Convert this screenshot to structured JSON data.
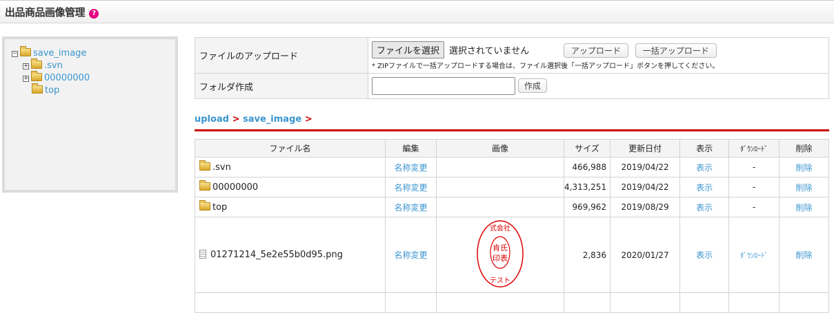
{
  "header": {
    "title": "出品商品画像管理",
    "help_icon": "?"
  },
  "tree": {
    "root": "save_image",
    "children": [
      {
        "label": ".svn",
        "expandable": true
      },
      {
        "label": "00000000",
        "expandable": true
      },
      {
        "label": "top",
        "expandable": false
      }
    ]
  },
  "upload": {
    "label": "ファイルのアップロード",
    "choose_label": "ファイルを選択",
    "no_file": "選択されていません",
    "upload_button": "アップロード",
    "bulk_button": "一括アップロード",
    "note": "* ZIPファイルで一括アップロードする場合は、ファイル選択後「一括アップロード」ボタンを押してください。"
  },
  "folder": {
    "label": "フォルダ作成",
    "value": "",
    "create_button": "作成"
  },
  "breadcrumb": {
    "items": [
      "upload",
      "save_image"
    ],
    "sep": ">"
  },
  "files": {
    "headers": [
      "ファイル名",
      "編集",
      "画像",
      "サイズ",
      "更新日付",
      "表示",
      "ﾀﾞｳﾝﾛｰﾄﾞ",
      "削除"
    ],
    "rows": [
      {
        "name": ".svn",
        "type": "folder",
        "edit": "名称変更",
        "size": "466,988",
        "date": "2019/04/22",
        "show": "表示",
        "download": "-",
        "delete": "削除"
      },
      {
        "name": "00000000",
        "type": "folder",
        "edit": "名称変更",
        "size": "4,313,251",
        "date": "2019/04/22",
        "show": "表示",
        "download": "-",
        "delete": "削除"
      },
      {
        "name": "top",
        "type": "folder",
        "edit": "名称変更",
        "size": "969,962",
        "date": "2019/08/29",
        "show": "表示",
        "download": "-",
        "delete": "削除"
      },
      {
        "name": "01271214_5e2e55b0d95.png",
        "type": "file",
        "edit": "名称変更",
        "size": "2,836",
        "date": "2020/01/27",
        "show": "表示",
        "download": "ﾀﾞｳﾝﾛｰﾄﾞ",
        "delete": "削除",
        "image": "red-seal-stamp"
      }
    ]
  },
  "colors": {
    "accent": "#cc0000",
    "link": "#3a95cf",
    "help": "#e4007f"
  }
}
